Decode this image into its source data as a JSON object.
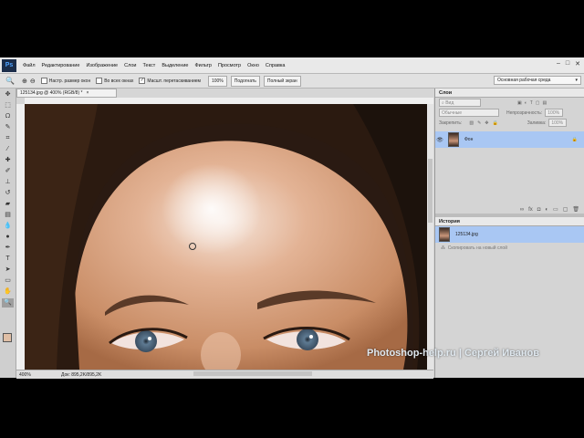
{
  "app": {
    "logo": "Ps",
    "menu": [
      "Файл",
      "Редактирование",
      "Изображение",
      "Слои",
      "Текст",
      "Выделение",
      "Фильтр",
      "Просмотр",
      "Окно",
      "Справка"
    ],
    "window_controls": [
      "–",
      "□",
      "✕"
    ]
  },
  "options_bar": {
    "resize_windows_label": "Настр. размер окон",
    "all_windows_label": "Во всех окнах",
    "scrubby_zoom_label": "Масшт. перетаскиванием",
    "scrubby_zoom_checked": "✓",
    "zoom_100": "100%",
    "fit_screen": "Подогнать",
    "fill_screen": "Полный экран",
    "workspace": "Основная рабочая среда"
  },
  "document": {
    "tab_title": "125134.jpg @ 400% (RGB/8) *",
    "close": "×",
    "zoom_level": "400%",
    "doc_info": "Док: 895,2K/895,2K",
    "watermark": "Photoshop-help.ru | Сергей Иванов"
  },
  "layers_panel": {
    "title": "Слои",
    "kind": "Вид",
    "blend_mode": "Обычные",
    "opacity_label": "Непрозрачность:",
    "opacity_value": "100%",
    "lock_label": "Закрепить:",
    "fill_label": "Заливка:",
    "fill_value": "100%",
    "layer_name": "Фон",
    "footer_icons": [
      "link-icon",
      "fx-icon",
      "mask-icon",
      "adjustment-icon",
      "group-icon",
      "new-layer-icon",
      "trash-icon"
    ]
  },
  "history_panel": {
    "title": "История",
    "snapshot_name": "125134.jpg",
    "command": "Скопировать на новый слой"
  },
  "tools": [
    "move",
    "marquee",
    "lasso",
    "quick-select",
    "crop",
    "eyedropper",
    "healing",
    "brush",
    "stamp",
    "history-brush",
    "eraser",
    "gradient",
    "blur",
    "dodge",
    "pen",
    "type",
    "path-select",
    "shape",
    "hand",
    "zoom"
  ],
  "colors": {
    "foreground": "#e0bfa6",
    "background": "#ffffff",
    "selection": "#a9c7f3"
  }
}
